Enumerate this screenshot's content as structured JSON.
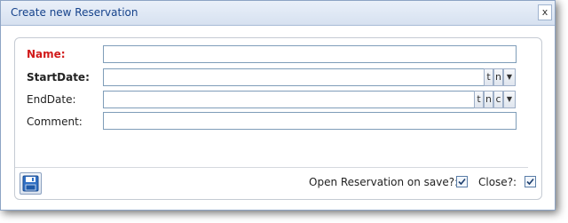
{
  "dialog": {
    "title": "Create new Reservation",
    "close_label": "x"
  },
  "form": {
    "name_label": "Name:",
    "name_value": "",
    "startdate_label": "StartDate:",
    "startdate_value": "",
    "startdate_buttons": [
      "t",
      "n"
    ],
    "enddate_label": "EndDate:",
    "enddate_value": "",
    "enddate_buttons": [
      "t",
      "n",
      "c"
    ],
    "comment_label": "Comment:",
    "comment_value": ""
  },
  "footer": {
    "save_icon": "floppy-disk-icon",
    "open_on_save_label": "Open Reservation on save?:",
    "open_on_save_checked": true,
    "close_label": "Close?:",
    "close_checked": true
  },
  "colors": {
    "title_text": "#15428b",
    "required_label": "#d11a1a",
    "field_border": "#7f9db9"
  }
}
